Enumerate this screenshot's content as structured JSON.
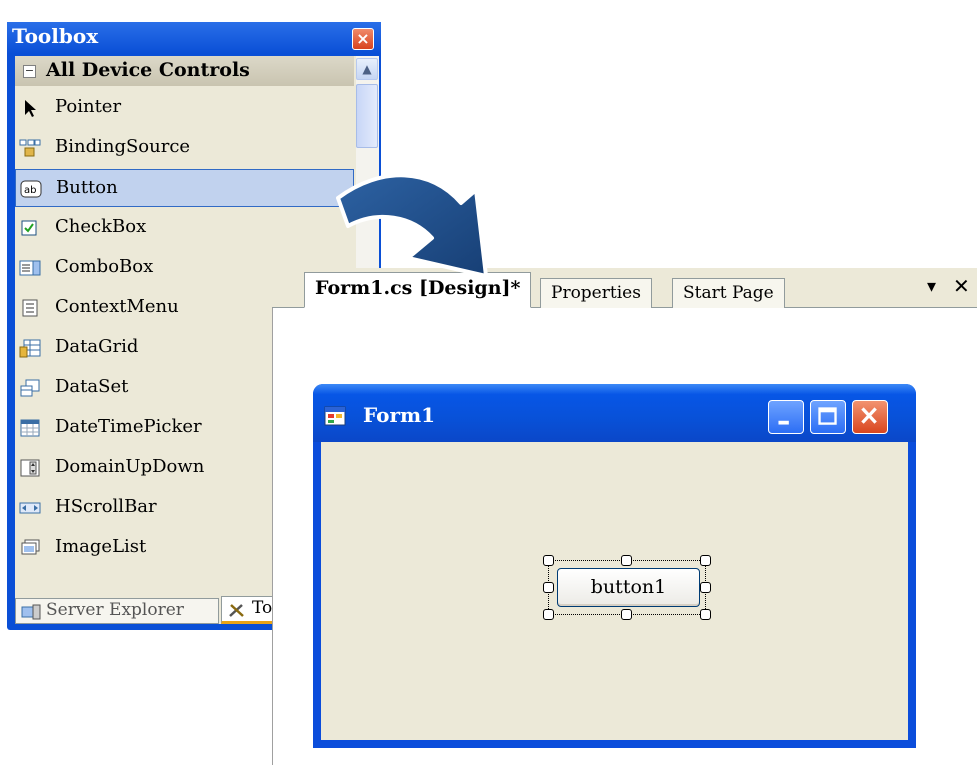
{
  "toolbox": {
    "title": "Toolbox",
    "section_title": "All Device Controls",
    "items": [
      {
        "label": "Pointer",
        "icon": "pointer-icon",
        "selected": false
      },
      {
        "label": "BindingSource",
        "icon": "binding-source-icon",
        "selected": false
      },
      {
        "label": "Button",
        "icon": "button-icon",
        "selected": true
      },
      {
        "label": "CheckBox",
        "icon": "checkbox-icon",
        "selected": false
      },
      {
        "label": "ComboBox",
        "icon": "combobox-icon",
        "selected": false
      },
      {
        "label": "ContextMenu",
        "icon": "context-menu-icon",
        "selected": false
      },
      {
        "label": "DataGrid",
        "icon": "data-grid-icon",
        "selected": false
      },
      {
        "label": "DataSet",
        "icon": "dataset-icon",
        "selected": false
      },
      {
        "label": "DateTimePicker",
        "icon": "date-time-picker-icon",
        "selected": false
      },
      {
        "label": "DomainUpDown",
        "icon": "domain-up-down-icon",
        "selected": false
      },
      {
        "label": "HScrollBar",
        "icon": "hscrollbar-icon",
        "selected": false
      },
      {
        "label": "ImageList",
        "icon": "image-list-icon",
        "selected": false
      }
    ],
    "bottom_tabs": [
      {
        "label": "Server Explorer",
        "active": false
      },
      {
        "label": "To",
        "active": true
      }
    ]
  },
  "designer": {
    "tabs": [
      {
        "label": "Form1.cs [Design]*",
        "active": true
      },
      {
        "label": "Properties",
        "active": false
      },
      {
        "label": "Start Page",
        "active": false
      }
    ],
    "dropdown_glyph": "▾",
    "close_glyph": "✕"
  },
  "form": {
    "title": "Form1",
    "button_label": "button1"
  },
  "colors": {
    "xp_blue": "#0a4fd6",
    "arrow": "#1f4e8c",
    "selection_highlight": "#c1d2ee",
    "window_face": "#ece9d8"
  }
}
